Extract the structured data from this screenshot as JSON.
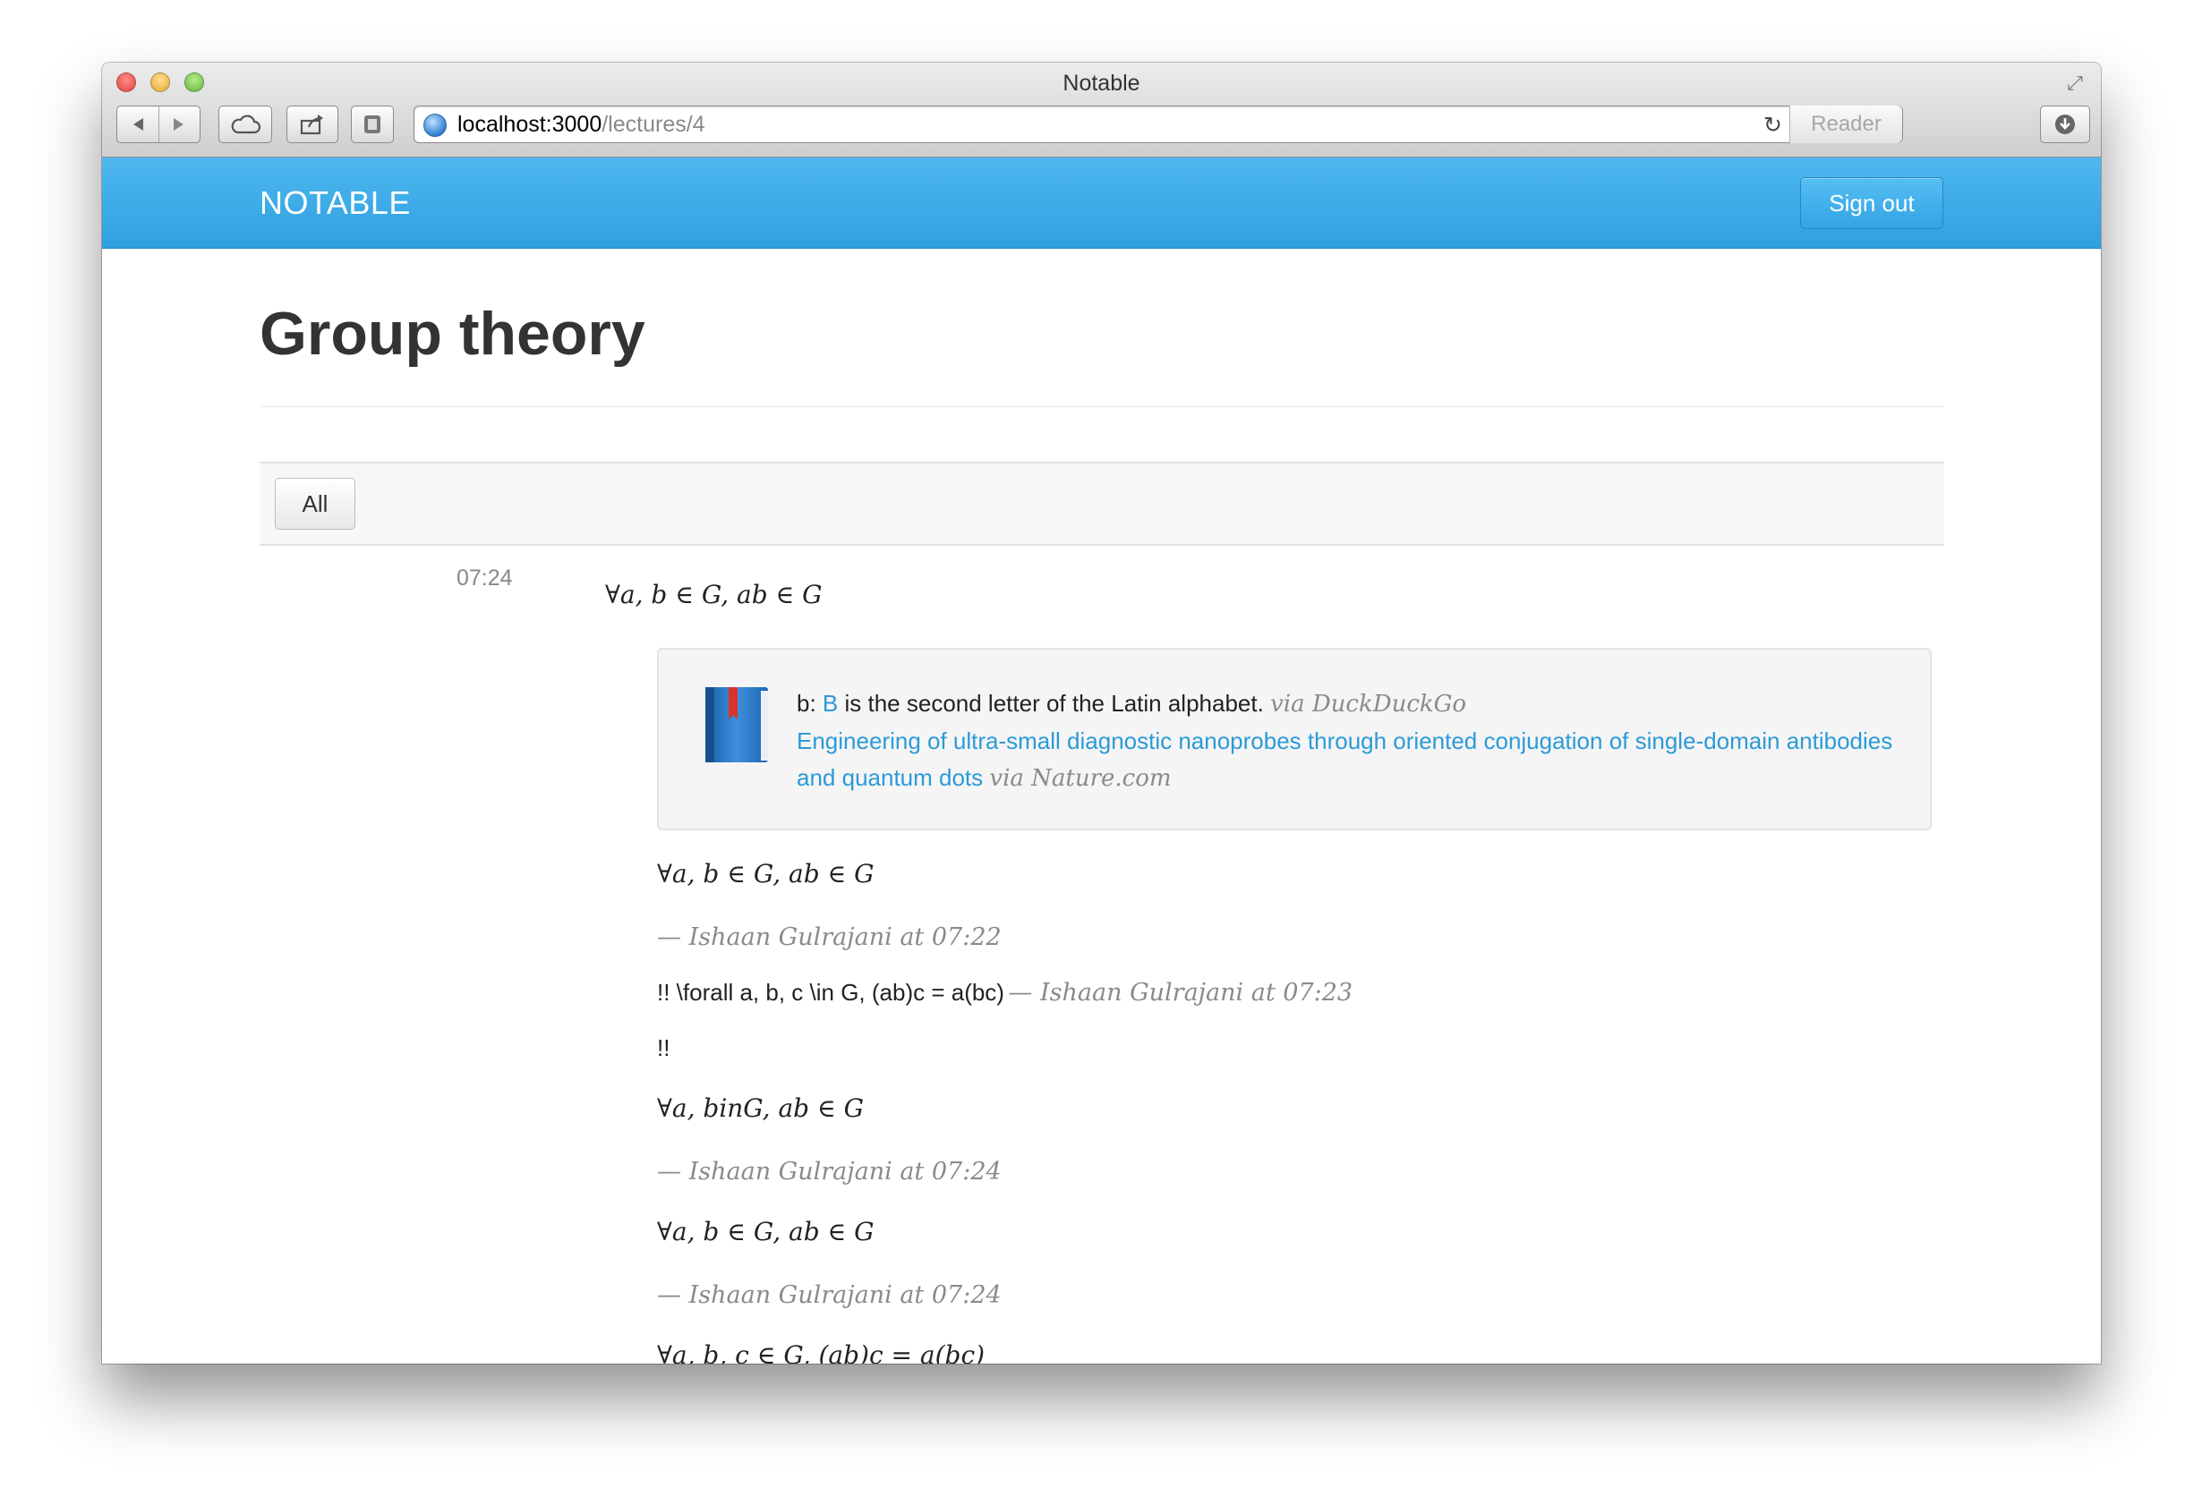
{
  "window": {
    "title": "Notable"
  },
  "toolbar": {
    "url_host": "localhost:3000",
    "url_path": "/lectures/4",
    "reader_label": "Reader"
  },
  "navbar": {
    "brand": "NOTABLE",
    "signout_label": "Sign out"
  },
  "page": {
    "title": "Group theory",
    "filter_all_label": "All"
  },
  "entry": {
    "timestamp": "07:24",
    "math": "∀a, b ∈ G, ab ∈ G",
    "lookup": {
      "term_prefix": "b:",
      "term_link": "B",
      "term_text": "is the second letter of the Latin alphabet.",
      "term_source": "via DuckDuckGo",
      "article_link": "Engineering of ultra-small diagnostic nanoprobes through oriented conjugation of single-domain antibodies and quantum dots",
      "article_source": "via Nature.com"
    },
    "notes": [
      {
        "kind": "math",
        "text": "∀a, b ∈ G, ab ∈ G"
      },
      {
        "kind": "meta",
        "text": "— Ishaan Gulrajani at 07:22"
      },
      {
        "kind": "raw",
        "text": "!! \\forall a, b, c \\in G, (ab)c = a(bc)",
        "meta": "— Ishaan Gulrajani at 07:23"
      },
      {
        "kind": "plain",
        "text": "!!"
      },
      {
        "kind": "math",
        "text": "∀a, binG, ab ∈ G"
      },
      {
        "kind": "meta",
        "text": "— Ishaan Gulrajani at 07:24"
      },
      {
        "kind": "math",
        "text": "∀a, b ∈ G, ab ∈ G"
      },
      {
        "kind": "meta",
        "text": "— Ishaan Gulrajani at 07:24"
      },
      {
        "kind": "math",
        "text": "∀a, b, c ∈ G, (ab)c = a(bc)"
      }
    ]
  },
  "colors": {
    "navbar": "#3aa9e8",
    "link": "#2b9ad9"
  }
}
